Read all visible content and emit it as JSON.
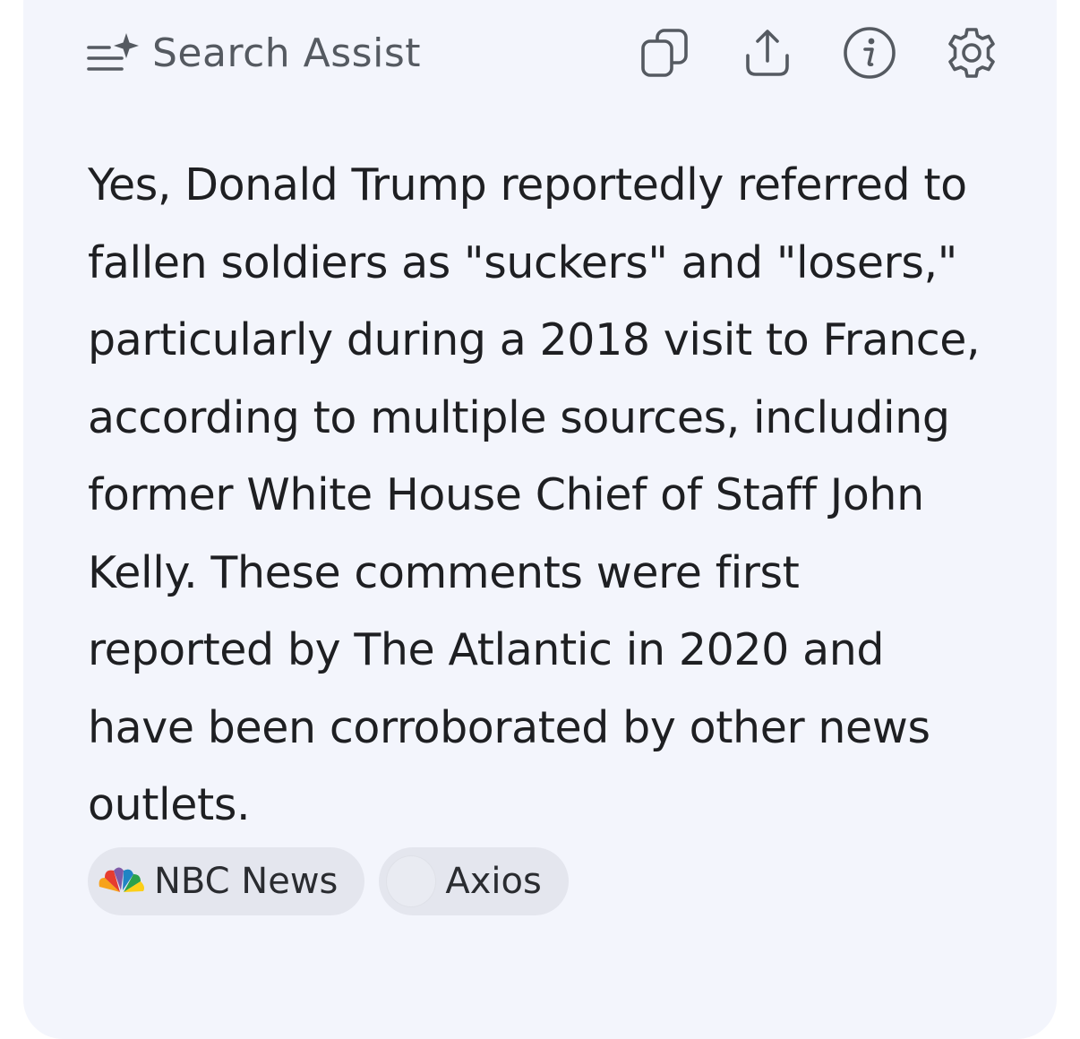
{
  "header": {
    "title": "Search Assist",
    "icons": {
      "brand": "sparkle-list-icon",
      "copy": "copy-icon",
      "share": "share-icon",
      "info": "info-icon",
      "settings": "gear-icon"
    }
  },
  "answer": {
    "text": "Yes, Donald Trump reportedly referred to fallen soldiers as \"suckers\" and \"losers,\" particularly during a 2018 visit to France, according to multiple sources, including former White House Chief of Staff John Kelly. These comments were first reported by The Atlantic in 2020 and have been corroborated by other news outlets."
  },
  "sources": [
    {
      "label": "NBC News",
      "icon": "nbc-peacock-icon"
    },
    {
      "label": "Axios",
      "icon": "axios-logo-icon"
    }
  ],
  "colors": {
    "card_background": "#f3f5fc",
    "text": "#1e1f22",
    "header_text": "#555a61",
    "chip_background": "#e4e6ee"
  }
}
